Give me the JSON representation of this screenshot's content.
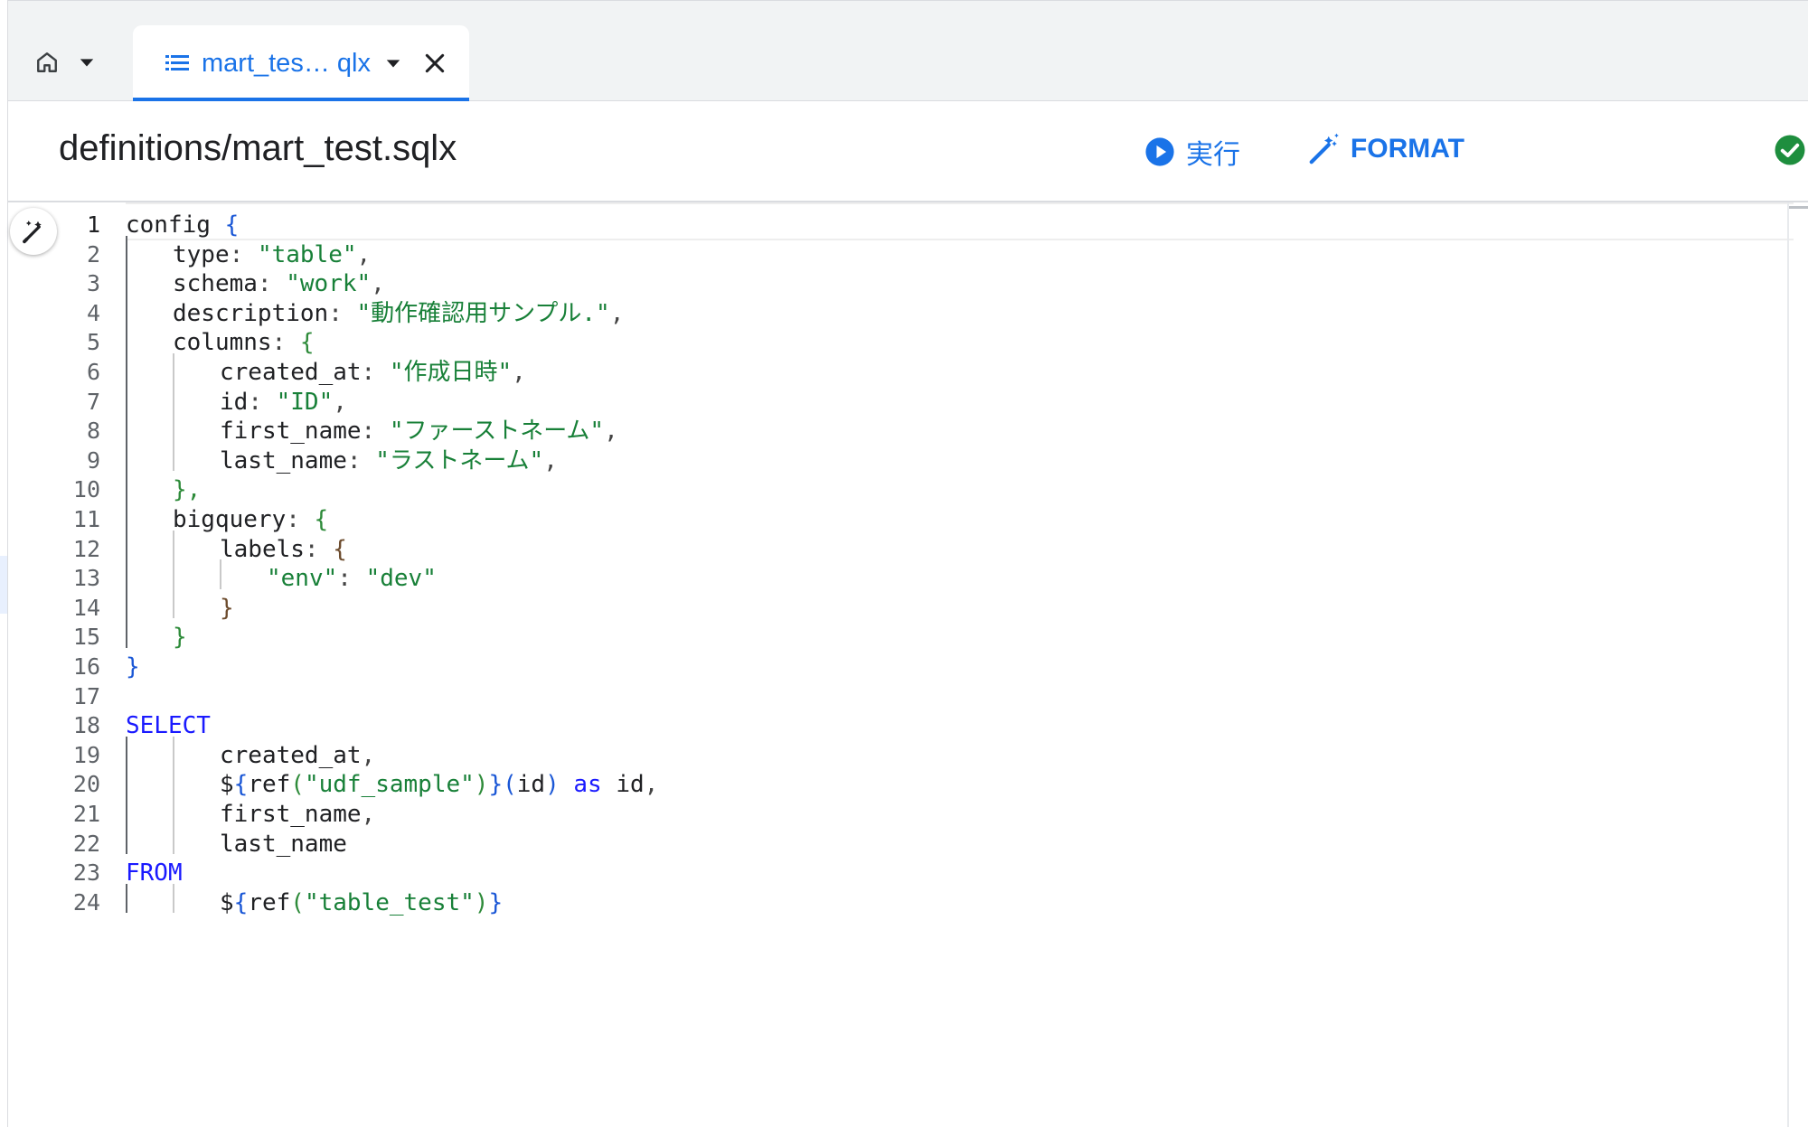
{
  "tabs": {
    "home_tab": {
      "icon": "home-icon",
      "menu_icon": "caret-down-icon"
    },
    "file_tab": {
      "label": "mart_tes… qlx",
      "icon": "list-icon",
      "menu_icon": "caret-down-icon",
      "close_icon": "close-icon"
    }
  },
  "header": {
    "file_path": "definitions/mart_test.sqlx",
    "run_label": "実行",
    "format_label": "FORMAT",
    "status": "compiled-ok"
  },
  "editor": {
    "active_line": 1,
    "line_numbers": [
      "1",
      "2",
      "3",
      "4",
      "5",
      "6",
      "7",
      "8",
      "9",
      "10",
      "11",
      "12",
      "13",
      "14",
      "15",
      "16",
      "17",
      "18",
      "19",
      "20",
      "21",
      "22",
      "23",
      "24"
    ],
    "lines": [
      [
        [
          "config ",
          "plain"
        ],
        [
          "{",
          "brace-blue"
        ]
      ],
      [
        [
          "type",
          ""
        ],
        [
          ": ",
          "punc"
        ],
        [
          "\"table\"",
          "str"
        ],
        [
          ",",
          "punc"
        ]
      ],
      [
        [
          "schema",
          ""
        ],
        [
          ": ",
          "punc"
        ],
        [
          "\"work\"",
          "str"
        ],
        [
          ",",
          "punc"
        ]
      ],
      [
        [
          "description",
          ""
        ],
        [
          ": ",
          "punc"
        ],
        [
          "\"動作確認用サンプル.\"",
          "str"
        ],
        [
          ",",
          "punc"
        ]
      ],
      [
        [
          "columns",
          ""
        ],
        [
          ": ",
          "punc"
        ],
        [
          "{",
          "brace-green"
        ]
      ],
      [
        [
          "created_at",
          ""
        ],
        [
          ": ",
          "punc"
        ],
        [
          "\"作成日時\"",
          "str"
        ],
        [
          ",",
          "punc"
        ]
      ],
      [
        [
          "id",
          ""
        ],
        [
          ": ",
          "punc"
        ],
        [
          "\"ID\"",
          "str"
        ],
        [
          ",",
          "punc"
        ]
      ],
      [
        [
          "first_name",
          ""
        ],
        [
          ": ",
          "punc"
        ],
        [
          "\"ファーストネーム\"",
          "str"
        ],
        [
          ",",
          "punc"
        ]
      ],
      [
        [
          "last_name",
          ""
        ],
        [
          ": ",
          "punc"
        ],
        [
          "\"ラストネーム\"",
          "str"
        ],
        [
          ",",
          "punc"
        ]
      ],
      [
        [
          "},",
          "brace-green"
        ]
      ],
      [
        [
          "bigquery",
          ""
        ],
        [
          ": ",
          "punc"
        ],
        [
          "{",
          "brace-green"
        ]
      ],
      [
        [
          "labels",
          ""
        ],
        [
          ": ",
          "punc"
        ],
        [
          "{",
          "brace-brown"
        ]
      ],
      [
        [
          "\"env\"",
          "str"
        ],
        [
          ": ",
          "punc"
        ],
        [
          "\"dev\"",
          "str"
        ]
      ],
      [
        [
          "}",
          "brace-brown"
        ]
      ],
      [
        [
          "}",
          "brace-green"
        ]
      ],
      [
        [
          "}",
          "brace-blue"
        ]
      ],
      [],
      [
        [
          "SELECT",
          "kw"
        ]
      ],
      [
        [
          "created_at",
          ""
        ],
        [
          ",",
          "punc"
        ]
      ],
      [
        [
          "$",
          "plain"
        ],
        [
          "{",
          "brace-blue"
        ],
        [
          "ref",
          "plain"
        ],
        [
          "(",
          "brace-green"
        ],
        [
          "\"udf_sample\"",
          "str"
        ],
        [
          ")",
          "brace-green"
        ],
        [
          "}",
          "brace-blue"
        ],
        [
          "(",
          "brace-blue"
        ],
        [
          "id",
          "plain"
        ],
        [
          ")",
          "brace-blue"
        ],
        [
          " as ",
          "kw"
        ],
        [
          "id",
          "plain"
        ],
        [
          ",",
          "punc"
        ]
      ],
      [
        [
          "first_name",
          ""
        ],
        [
          ",",
          "punc"
        ]
      ],
      [
        [
          "last_name",
          ""
        ]
      ],
      [
        [
          "FROM",
          "kw"
        ]
      ],
      [
        [
          "$",
          "plain"
        ],
        [
          "{",
          "brace-blue"
        ],
        [
          "ref",
          "plain"
        ],
        [
          "(",
          "brace-green"
        ],
        [
          "\"table_test\"",
          "str"
        ],
        [
          ")",
          "brace-green"
        ],
        [
          "}",
          "brace-blue"
        ]
      ]
    ],
    "indents": [
      0,
      1,
      1,
      1,
      1,
      2,
      2,
      2,
      2,
      1,
      1,
      2,
      3,
      2,
      1,
      0,
      0,
      0,
      2,
      2,
      2,
      2,
      0,
      2
    ]
  },
  "colors": {
    "accent": "#1a73e8",
    "keyword": "#1a1aff",
    "string": "#188038",
    "success": "#1e8e3e"
  }
}
